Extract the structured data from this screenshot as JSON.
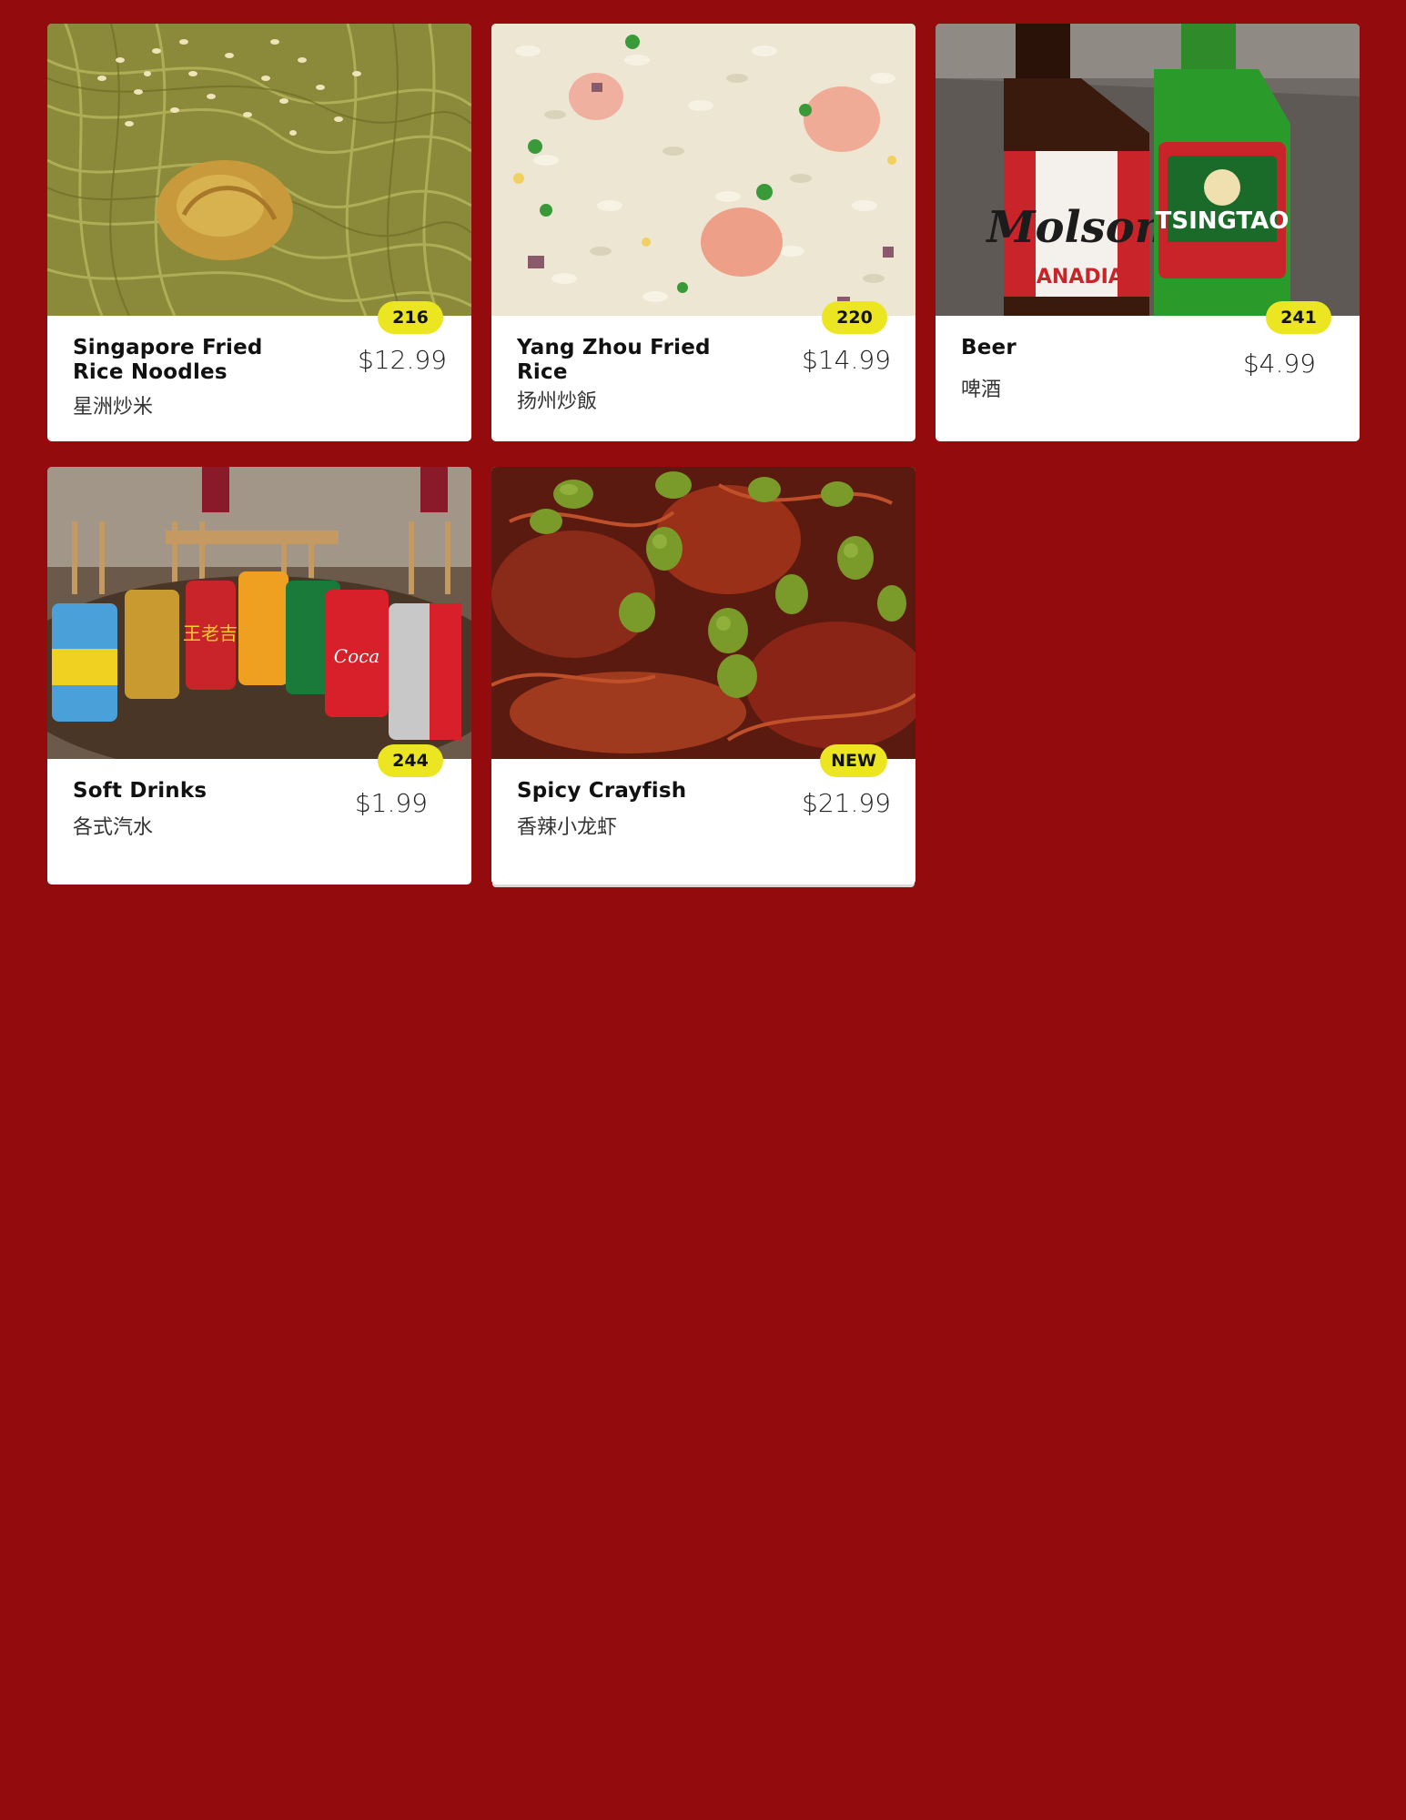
{
  "menu": {
    "items": [
      {
        "name": "Singapore Fried Rice Noodles",
        "chinese": "星洲炒米",
        "price": "$12.99",
        "badge": "216",
        "image": "singapore-noodles-photo"
      },
      {
        "name": "Yang Zhou Fried Rice",
        "chinese": "扬州炒飯",
        "price": "$14.99",
        "badge": "220",
        "image": "fried-rice-photo"
      },
      {
        "name": "Beer",
        "chinese": "啤酒",
        "price": "$4.99",
        "badge": "241",
        "image": "beer-bottles-photo"
      },
      {
        "name": "Soft Drinks",
        "chinese": "各式汽水",
        "price": "$1.99",
        "badge": "244",
        "image": "soft-drink-cans-photo"
      },
      {
        "name": "Spicy Crayfish",
        "chinese": "香辣小龙虾",
        "price": "$21.99",
        "badge": "NEW",
        "image": "crayfish-photo"
      }
    ]
  },
  "colors": {
    "background": "#930b0c",
    "card": "#ffffff",
    "badge": "#ece622"
  }
}
